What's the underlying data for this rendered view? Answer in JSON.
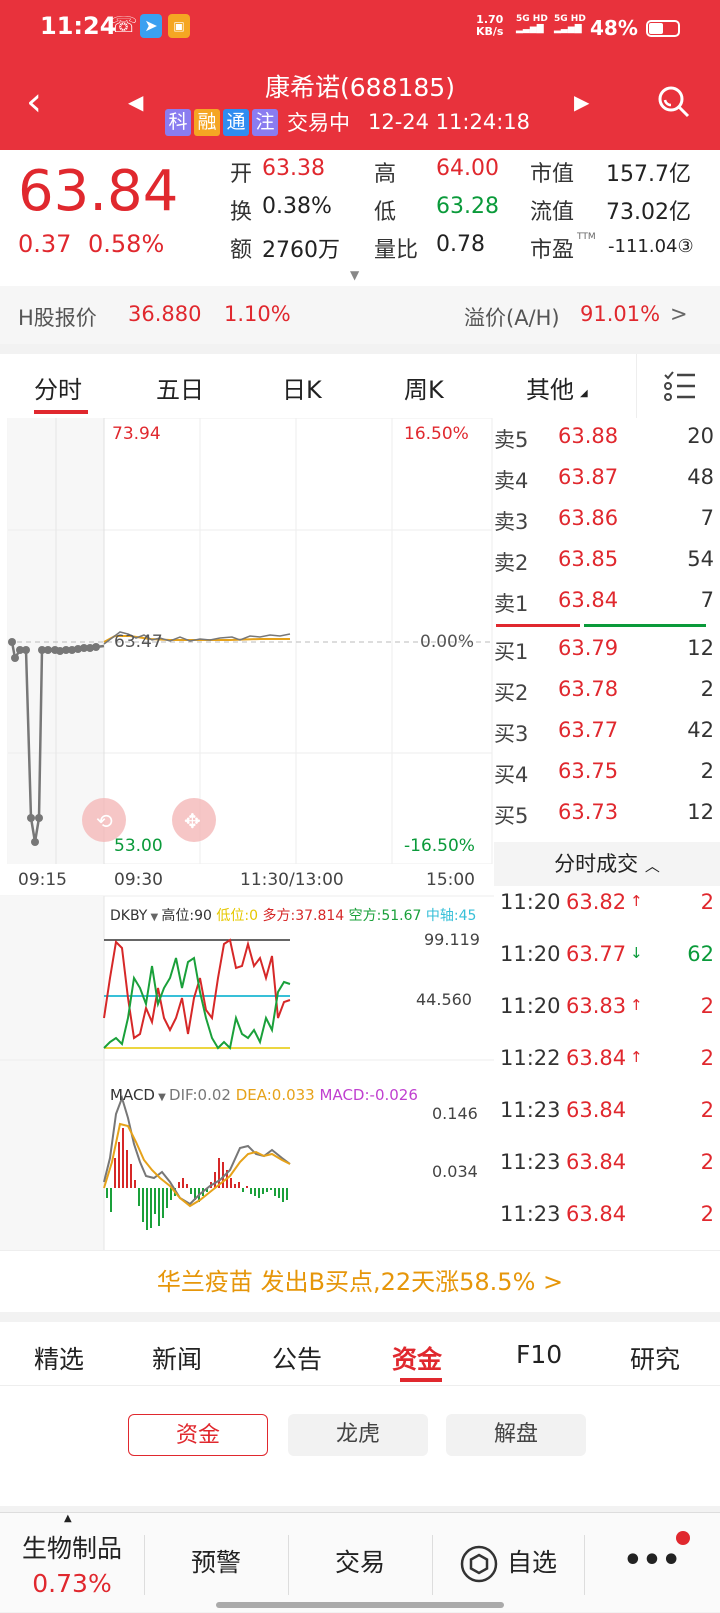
{
  "status_bar": {
    "time": "11:24",
    "net_speed": "1.70",
    "net_unit": "KB/s",
    "sim1": "5G HD",
    "sim2": "5G HD",
    "battery": "48%"
  },
  "header": {
    "title": "康希诺(688185)",
    "tags": [
      "科",
      "融",
      "通",
      "注"
    ],
    "tag_colors": [
      "#8a7cf0",
      "#f5a623",
      "#2f8cf0",
      "#8a7cf0"
    ],
    "status": "交易中",
    "datetime": "12-24 11:24:18"
  },
  "quote": {
    "price": "63.84",
    "change": "0.37",
    "change_pct": "0.58%",
    "open_label": "开",
    "open": "63.38",
    "high_label": "高",
    "high": "64.00",
    "mktcap_label": "市值",
    "mktcap": "157.7亿",
    "turnover_label": "换",
    "turnover": "0.38%",
    "low_label": "低",
    "low": "63.28",
    "float_label": "流值",
    "float": "73.02亿",
    "amount_label": "额",
    "amount": "2760万",
    "volratio_label": "量比",
    "volratio": "0.78",
    "pe_label": "市盈",
    "pe_sup": "TTM",
    "pe": "-111.04③"
  },
  "hshare": {
    "label": "H股报价",
    "price": "36.880",
    "pct": "1.10%",
    "premium_label": "溢价(A/H)",
    "premium": "91.01%",
    "arrow": ">"
  },
  "tabs": [
    "分时",
    "五日",
    "日K",
    "周K",
    "其他"
  ],
  "tabs_active": 0,
  "chart": {
    "top_price": "73.94",
    "top_pct": "16.50%",
    "base_price": "63.47",
    "base_pct": "0.00%",
    "bottom_price": "53.00",
    "bottom_pct": "-16.50%",
    "times": [
      "09:15",
      "09:30",
      "11:30/13:00",
      "15:00"
    ],
    "dkby": {
      "name": "DKBY",
      "high": "高位:90",
      "low": "低位:0",
      "long": "多方:37.814",
      "short": "空方:51.67",
      "mid": "中轴:45",
      "top": "99.119",
      "midv": "44.560"
    },
    "macd": {
      "name": "MACD",
      "dif": "DIF:0.02",
      "dea": "DEA:0.033",
      "macd": "MACD:-0.026",
      "top": "0.146",
      "midv": "0.034"
    }
  },
  "orderbook": {
    "asks": [
      {
        "label": "卖5",
        "price": "63.88",
        "vol": "20"
      },
      {
        "label": "卖4",
        "price": "63.87",
        "vol": "48"
      },
      {
        "label": "卖3",
        "price": "63.86",
        "vol": "7"
      },
      {
        "label": "卖2",
        "price": "63.85",
        "vol": "54"
      },
      {
        "label": "卖1",
        "price": "63.84",
        "vol": "7"
      }
    ],
    "bids": [
      {
        "label": "买1",
        "price": "63.79",
        "vol": "12"
      },
      {
        "label": "买2",
        "price": "63.78",
        "vol": "2"
      },
      {
        "label": "买3",
        "price": "63.77",
        "vol": "42"
      },
      {
        "label": "买4",
        "price": "63.75",
        "vol": "2"
      },
      {
        "label": "买5",
        "price": "63.73",
        "vol": "12"
      }
    ],
    "trades_header": "分时成交",
    "trades": [
      {
        "time": "11:20",
        "price": "63.82",
        "dir": "↑",
        "vol": "2"
      },
      {
        "time": "11:20",
        "price": "63.77",
        "dir": "↓",
        "vol": "62"
      },
      {
        "time": "11:20",
        "price": "63.83",
        "dir": "↑",
        "vol": "2"
      },
      {
        "time": "11:22",
        "price": "63.84",
        "dir": "↑",
        "vol": "2"
      },
      {
        "time": "11:23",
        "price": "63.84",
        "dir": "",
        "vol": "2"
      },
      {
        "time": "11:23",
        "price": "63.84",
        "dir": "",
        "vol": "2"
      },
      {
        "time": "11:23",
        "price": "63.84",
        "dir": "",
        "vol": "2"
      }
    ]
  },
  "banner": "华兰疫苗 发出B买点,22天涨58.5% >",
  "tabs2": [
    "精选",
    "新闻",
    "公告",
    "资金",
    "F10",
    "研究"
  ],
  "tabs2_active": 3,
  "subtabs": [
    "资金",
    "龙虎",
    "解盘"
  ],
  "bottom": {
    "sector": "生物制品",
    "sector_pct": "0.73%",
    "alert": "预警",
    "trade": "交易",
    "watch": "自选"
  }
}
